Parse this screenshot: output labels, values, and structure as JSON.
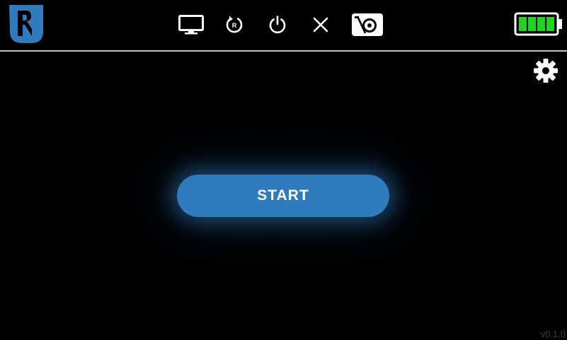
{
  "topbar": {
    "logo": {
      "icon": "robot-logo-icon",
      "color": "#2f7bbd"
    },
    "buttons": [
      {
        "id": "display",
        "icon": "monitor-icon"
      },
      {
        "id": "reset",
        "icon": "reset-icon",
        "glyph": "R"
      },
      {
        "id": "power",
        "icon": "power-icon"
      },
      {
        "id": "close",
        "icon": "close-icon"
      },
      {
        "id": "camera",
        "icon": "camera-off-icon"
      }
    ],
    "battery": {
      "icon": "battery-icon",
      "level": 1.0,
      "color": "#22d422"
    }
  },
  "settings": {
    "icon": "gear-icon"
  },
  "main": {
    "start_label": "START",
    "button_color": "#2f7bbd"
  },
  "footer": {
    "version": "v0.1.0"
  }
}
